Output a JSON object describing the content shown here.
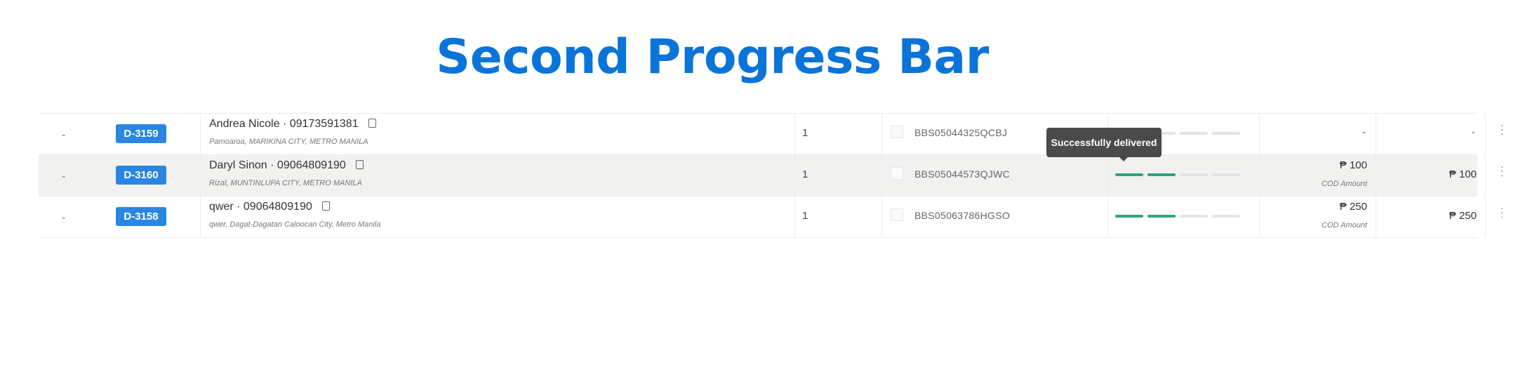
{
  "heading": "Second Progress Bar",
  "tooltip": "Successfully delivered",
  "progress_colors": {
    "done": "#2aa57e",
    "pending": "#e3e3e3"
  },
  "rows": [
    {
      "dash": "-",
      "id": "D-3159",
      "name": "Andrea Nicole · 09173591381",
      "address": "Pamoaroa, MARIKINA CITY, METRO MANILA",
      "qty": "1",
      "tracking": "BBS05044325QCBJ",
      "progress": {
        "done": 0,
        "total": 4
      },
      "amount": "-",
      "amount_label": "",
      "total": "-",
      "menu": "⋮"
    },
    {
      "dash": "-",
      "id": "D-3160",
      "name": "Daryl Sinon · 09064809190",
      "address": "Rizal, MUNTINLUPA CITY, METRO MANILA",
      "qty": "1",
      "tracking": "BBS05044573QJWC",
      "progress": {
        "done": 2,
        "total": 4
      },
      "amount": "₱ 100",
      "amount_label": "COD Amount",
      "total": "₱ 100",
      "menu": "⋮"
    },
    {
      "dash": "-",
      "id": "D-3158",
      "name": "qwer · 09064809190",
      "address": "qwer, Dagat-Dagatan Caloocan City, Metro Manila",
      "qty": "1",
      "tracking": "BBS05063786HGSO",
      "progress": {
        "done": 2,
        "total": 4
      },
      "amount": "₱ 250",
      "amount_label": "COD Amount",
      "total": "₱ 250",
      "menu": "⋮"
    }
  ]
}
